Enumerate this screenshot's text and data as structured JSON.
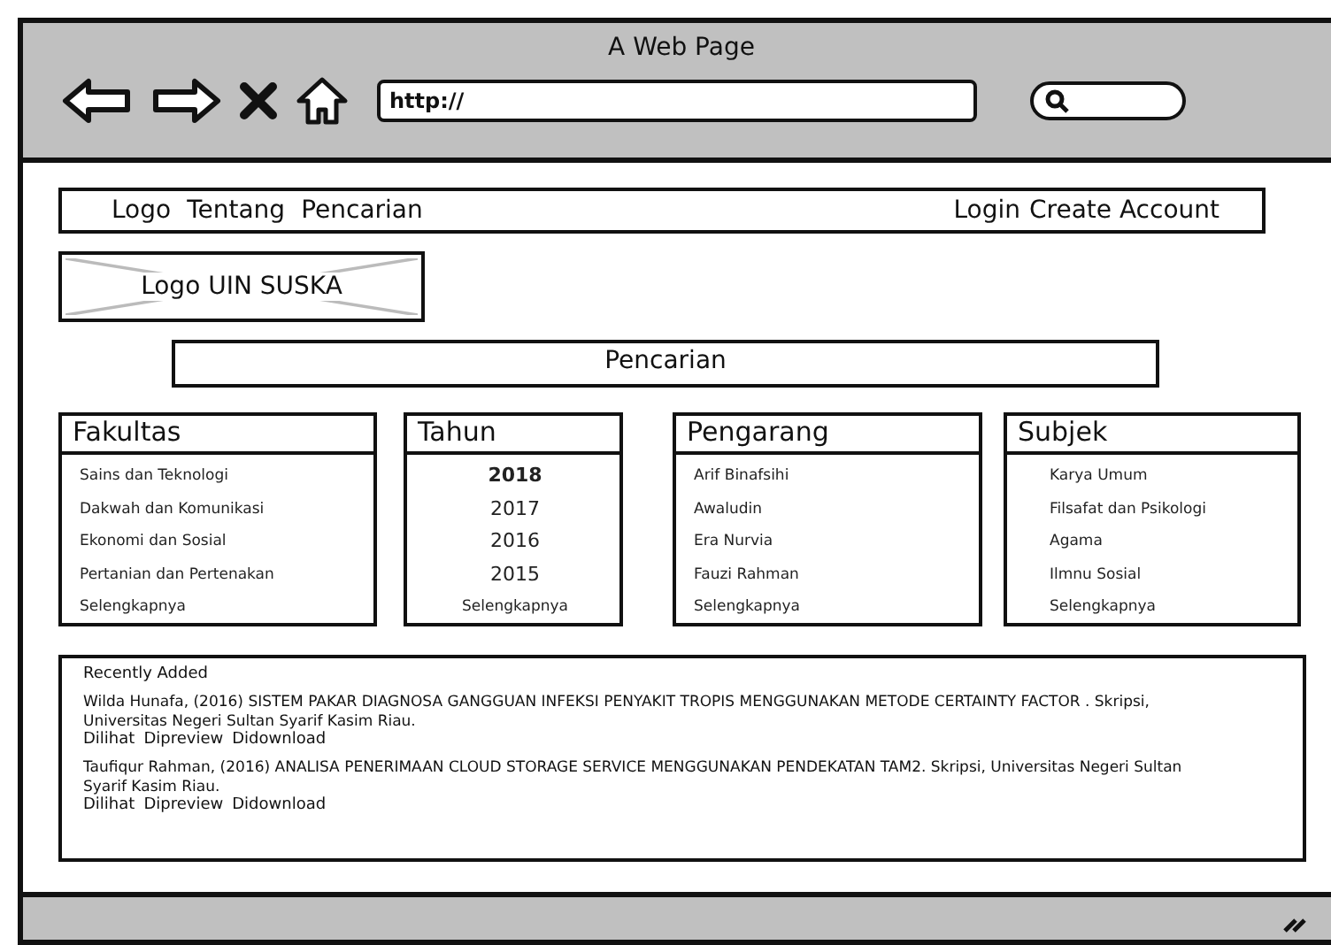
{
  "window": {
    "title": "A Web Page"
  },
  "toolbar": {
    "url": "http://"
  },
  "nav": {
    "left": [
      "Logo",
      "Tentang",
      "Pencarian"
    ],
    "right": [
      "Login",
      "Create Account"
    ]
  },
  "logo": {
    "label": "Logo UIN SUSKA"
  },
  "search": {
    "label": "Pencarian"
  },
  "columns": [
    {
      "title": "Fakultas",
      "items": [
        {
          "label": "Sains dan Teknologi",
          "selected": false
        },
        {
          "label": "Dakwah dan Komunikasi",
          "selected": false
        },
        {
          "label": "Ekonomi dan Sosial",
          "selected": false
        },
        {
          "label": "Pertanian dan Pertenakan",
          "selected": false
        },
        {
          "label": "Selengkapnya",
          "selected": false
        }
      ]
    },
    {
      "title": "Tahun",
      "items": [
        {
          "label": "2018",
          "selected": true
        },
        {
          "label": "2017",
          "selected": false
        },
        {
          "label": "2016",
          "selected": false
        },
        {
          "label": "2015",
          "selected": false
        },
        {
          "label": "Selengkapnya",
          "selected": false
        }
      ]
    },
    {
      "title": "Pengarang",
      "items": [
        {
          "label": "Arif Binafsihi",
          "selected": false
        },
        {
          "label": "Awaludin",
          "selected": false
        },
        {
          "label": "Era Nurvia",
          "selected": false
        },
        {
          "label": "Fauzi Rahman",
          "selected": false
        },
        {
          "label": "Selengkapnya",
          "selected": false
        }
      ]
    },
    {
      "title": "Subjek",
      "items": [
        {
          "label": "Karya Umum",
          "selected": false
        },
        {
          "label": "Filsafat dan Psikologi",
          "selected": false
        },
        {
          "label": "Agama",
          "selected": false
        },
        {
          "label": "Ilmnu Sosial",
          "selected": false
        },
        {
          "label": "Selengkapnya",
          "selected": false
        }
      ]
    }
  ],
  "recent": {
    "title": "Recently Added",
    "entries": [
      {
        "citation": "Wilda Hunafa, (2016) SISTEM PAKAR DIAGNOSA GANGGUAN INFEKSI PENYAKIT TROPIS MENGGUNAKAN METODE CERTAINTY FACTOR . Skripsi, Universitas Negeri Sultan Syarif Kasim Riau.",
        "actions": [
          "Dilihat",
          "Dipreview",
          "Didownload"
        ]
      },
      {
        "citation": "Taufiqur Rahman, (2016) ANALISA PENERIMAAN CLOUD STORAGE SERVICE MENGGUNAKAN PENDEKATAN TAM2. Skripsi, Universitas Negeri Sultan Syarif Kasim Riau.",
        "actions": [
          "Dilihat",
          "Dipreview",
          "Didownload"
        ]
      }
    ]
  }
}
